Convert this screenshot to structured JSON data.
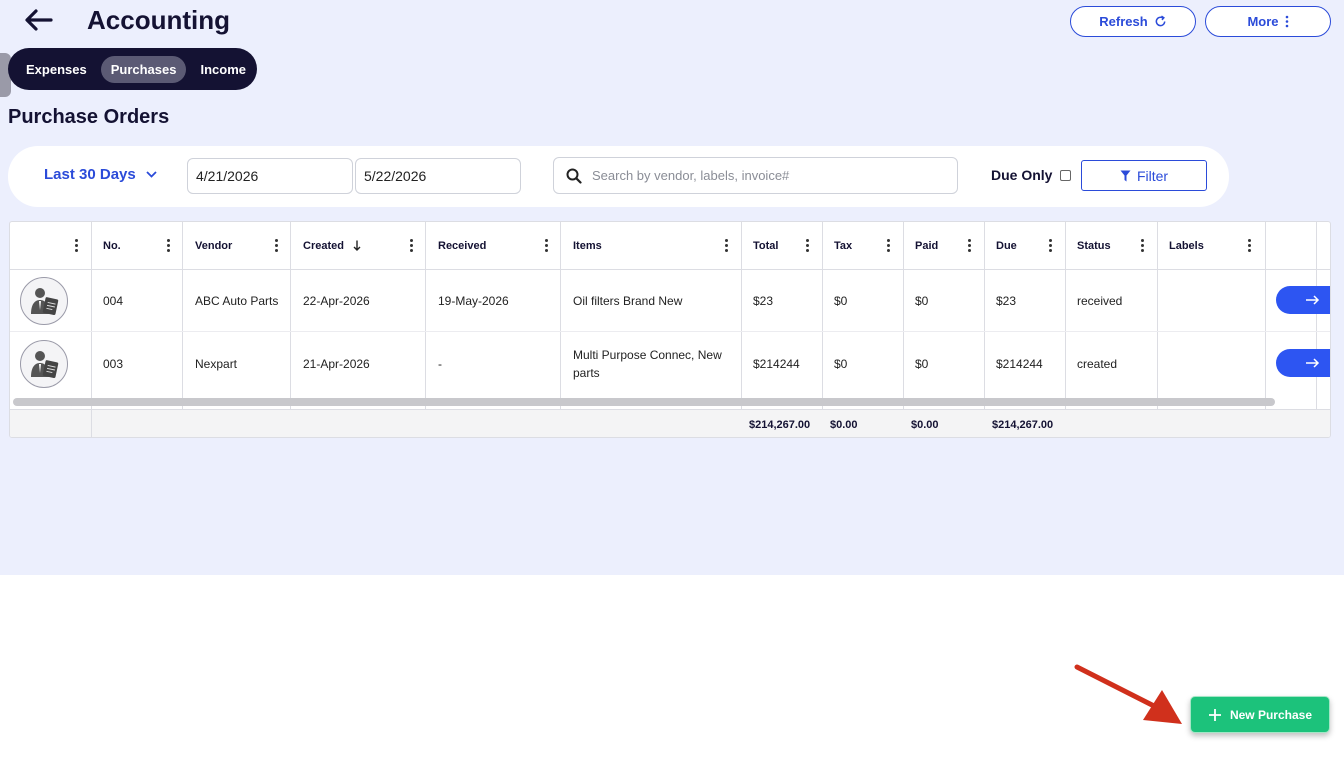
{
  "header": {
    "title": "Accounting",
    "refresh_label": "Refresh",
    "more_label": "More"
  },
  "tabs": [
    {
      "label": "Expenses",
      "active": false
    },
    {
      "label": "Purchases",
      "active": true
    },
    {
      "label": "Income",
      "active": false
    }
  ],
  "section_title": "Purchase Orders",
  "filters": {
    "range_label": "Last 30 Days",
    "date_from": "4/21/2026",
    "date_to": "5/22/2026",
    "search_placeholder": "Search by vendor, labels, invoice#",
    "due_only_label": "Due Only",
    "due_only_checked": false,
    "filter_label": "Filter"
  },
  "table": {
    "columns": [
      "",
      "No.",
      "Vendor",
      "Created",
      "Received",
      "Items",
      "Total",
      "Tax",
      "Paid",
      "Due",
      "Status",
      "Labels"
    ],
    "sort_column": "Created",
    "rows": [
      {
        "no": "004",
        "vendor": "ABC Auto Parts",
        "created": "22-Apr-2026",
        "received": "19-May-2026",
        "items_line1": "Oil filters Brand New",
        "items_line2": "",
        "total": "$23",
        "tax": "$0",
        "paid": "$0",
        "due": "$23",
        "status": "received",
        "labels": ""
      },
      {
        "no": "003",
        "vendor": "Nexpart",
        "created": "21-Apr-2026",
        "received": "-",
        "items_line1": "Multi Purpose Connec, New",
        "items_line2": "parts",
        "total": "$214244",
        "tax": "$0",
        "paid": "$0",
        "due": "$214244",
        "status": "created",
        "labels": ""
      }
    ],
    "footer": {
      "total": "$214,267.00",
      "tax": "$0.00",
      "paid": "$0.00",
      "due": "$214,267.00"
    }
  },
  "new_purchase_label": "New Purchase",
  "colors": {
    "accent": "#2b4bd9",
    "dark": "#141233",
    "green": "#1cc27b",
    "arrow": "#d0301c"
  }
}
